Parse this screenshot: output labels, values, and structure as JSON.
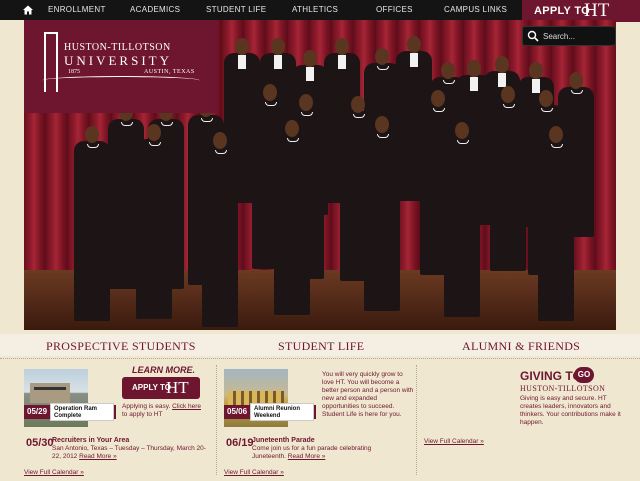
{
  "nav": {
    "items": [
      "ENROLLMENT",
      "ACADEMICS",
      "STUDENT LIFE",
      "ATHLETICS",
      "OFFICES",
      "CAMPUS LINKS"
    ],
    "apply_small": "APPLY TO",
    "apply_big": "HT"
  },
  "logo": {
    "line1": "HUSTON-TILLOTSON",
    "line2": "UNIVERSITY",
    "year": "1875",
    "location": "AUSTIN, TEXAS"
  },
  "search": {
    "placeholder": "Search..."
  },
  "sections": [
    "PROSPECTIVE STUDENTS",
    "STUDENT LIFE",
    "ALUMNI & FRIENDS"
  ],
  "prospective": {
    "feature_date": "05/29",
    "feature_title": "Operation Ram Complete",
    "learn_more": "LEARN MORE.",
    "apply_small": "APPLY TO",
    "apply_big": "HT",
    "apply_text": "Applying is easy.",
    "apply_link": "Click here",
    "apply_text2": "to apply to HT",
    "event_date": "05/30",
    "event_title": "Recruiters in Your Area",
    "event_desc": "San Antonio, Texas – Tuesday – Thursday, March 20-22, 2012",
    "read_more": "Read More »",
    "calendar": "View Full Calendar »"
  },
  "studentlife": {
    "feature_date": "05/06",
    "feature_title": "Alumni Reunion Weekend",
    "blurb": "You will very quickly grow to love HT. You will become a better person and a person with new and expanded opportunities to succeed. Student Life is here for you.",
    "event_date": "06/19",
    "event_title": "Juneteenth Parade",
    "event_desc": "Come join us for a fun parade celebrating Juneteenth.",
    "read_more": "Read More »",
    "calendar": "View Full Calendar »"
  },
  "alumni": {
    "calendar": "View Full Calendar »",
    "giving_title": "GIVING TO",
    "go": "GO",
    "giving_sub": "HUSTON-TILLOTSON",
    "giving_text": "Giving is easy and secure. HT creates leaders, innovators and thinkers. Your contributions make it happen."
  },
  "colors": {
    "brand": "#6e1630",
    "cream": "#efe7cf",
    "nav": "#141414"
  }
}
